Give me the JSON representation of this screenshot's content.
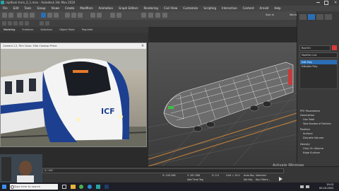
{
  "window": {
    "title": "rajdhani-train_0_1.max - Autodesk 3ds Max 2020"
  },
  "menu": {
    "items": [
      "File",
      "Edit",
      "Tools",
      "Group",
      "Views",
      "Create",
      "Modifiers",
      "Animation",
      "Graph Editors",
      "Rendering",
      "Civil View",
      "Customize",
      "Scripting",
      "Interactive",
      "Content",
      "Arnold",
      "Help"
    ]
  },
  "account": {
    "sign_in": "Sign In",
    "workspace": "Workspaces: Default"
  },
  "ribbon": {
    "tabs": [
      "Modeling",
      "Freeform",
      "Selection",
      "Object Paint",
      "Populate"
    ],
    "polygon_modeling": "Polygon Modeling"
  },
  "photo_window": {
    "title": "Camera 1.2, Film Close.  Elite Closeup Prime"
  },
  "train_photo": {
    "emblem_text": "ICF"
  },
  "right_panel": {
    "object_name": "Box001",
    "modifier_list": "Modifier List",
    "stack": [
      "Edit Poly",
      "Editable Poly"
    ],
    "rollout_title": "PFE Parameters",
    "subtitle": "Generation",
    "use_total": "Use Total",
    "total_number": "Total Number of Particles",
    "section_position": "Position",
    "opt_surface": "Surface",
    "opt_volume": "Discrete Volume",
    "section_density": "Density",
    "opt_only_volume": "Only On Volume",
    "opt_edge": "Edge Surface"
  },
  "timeline": {
    "frame": "0 / 100",
    "x": "X: 243.348",
    "y": "Y: 167.368",
    "z": "Z: 0.0",
    "grid": "Grid = 10.0",
    "auto_key": "Auto Key",
    "selected": "Selected",
    "set_key": "Set Key",
    "key_filters": "Key Filters...",
    "add_time_tag": "Add Time Tag"
  },
  "taskbar": {
    "search_placeholder": "Type here to search",
    "time": "19:13",
    "date": "00-10-2022"
  },
  "watermark": {
    "text": "Activate Windows"
  },
  "colors": {
    "viewport_bg": "#4c4c4c",
    "panel_bg": "#3a3a3a",
    "accent_blue": "#2a6fb5",
    "train_blue": "#1d3f8f",
    "wire_white": "#e8e8e8"
  }
}
